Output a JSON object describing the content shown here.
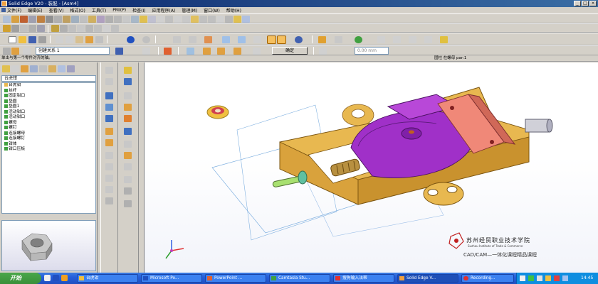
{
  "window": {
    "title": "Solid Edge V20 - 装配 - [Asm4]",
    "controls": [
      "_",
      "□",
      "×"
    ]
  },
  "menu": [
    "文件(F)",
    "编辑(E)",
    "查看(V)",
    "格式(O)",
    "工具(T)",
    "PMI(P)",
    "检查(I)",
    "应用程序(A)",
    "管理(M)",
    "窗口(W)",
    "帮助(H)"
  ],
  "ribbon": {
    "relation_label": "创建关系 1",
    "confirm_label": "确定",
    "offset_value": "0.00 mm"
  },
  "prompt": {
    "left": "单击与第一个零件对齐的轴。",
    "right": "固柱 在螺母 par:1"
  },
  "tree": {
    "dropdown": "台虎钳",
    "items": [
      "台虎钳",
      "丝杆",
      "固定钳口",
      "垫圈",
      "垫圈1",
      "活动钳口",
      "活动钳口",
      "螺母",
      "螺钉",
      "连接螺母",
      "连接螺钉",
      "钳体",
      "钳口压板"
    ]
  },
  "watermark": {
    "school": "苏州经贸职业技术学院",
    "school_en": "Suzhou Institute of Trade & Commerce",
    "course": "CAD/CAM—一体化课程精品课程"
  },
  "taskbar": {
    "start": "开始",
    "tasks": [
      "台虎钳",
      "Microsoft Po...",
      "PowerPoint ...",
      "Camtasia Stu...",
      "搜狗输入法帮",
      "Solid Edge V...",
      "Recording..."
    ],
    "clock": "14:45"
  },
  "colors": {
    "part_gold": "#e8b850",
    "part_purple": "#a030c8",
    "part_salmon": "#f08878",
    "accent_blue": "#245edb"
  }
}
